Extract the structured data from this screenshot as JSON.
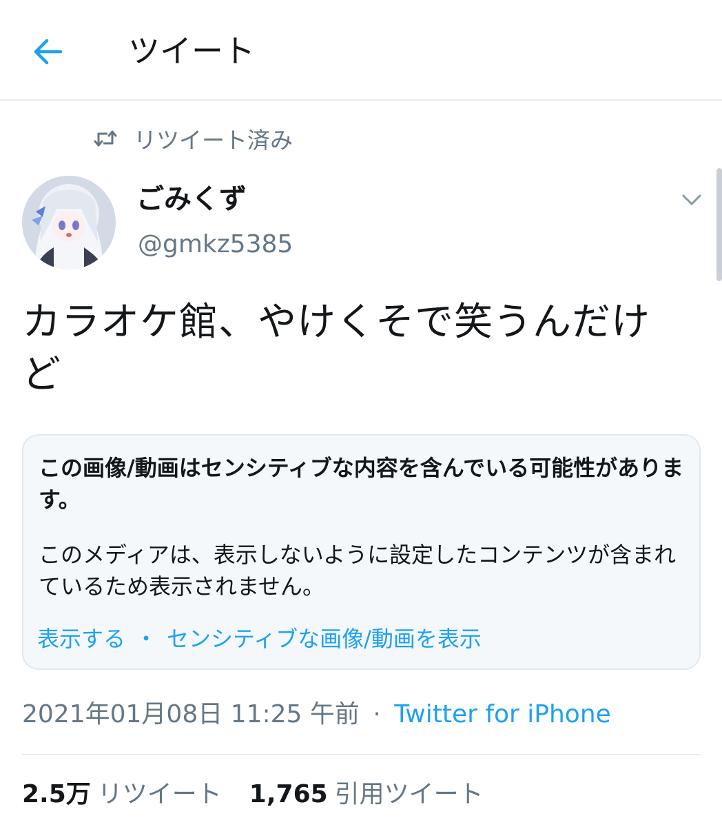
{
  "header": {
    "title": "ツイート",
    "back_icon": "arrow-left-icon"
  },
  "retweet_context": {
    "label": "リツイート済み",
    "icon": "retweet-icon"
  },
  "author": {
    "name": "ごみくず",
    "handle": "@gmkz5385",
    "avatar_icon": "avatar-illustration"
  },
  "tweet": {
    "text": "カラオケ館、やけくそで笑うんだけど"
  },
  "sensitive_notice": {
    "title": "この画像/動画はセンシティブな内容を含んでいる可能性があります。",
    "body": "このメディアは、表示しないように設定したコンテンツが含まれているため表示されません。",
    "show_label": "表示する",
    "separator": "・",
    "settings_label": "センシティブな画像/動画を表示"
  },
  "meta": {
    "timestamp": "2021年01月08日 11:25 午前",
    "separator": "·",
    "source": "Twitter for iPhone"
  },
  "stats": {
    "retweets_count": "2.5万",
    "retweets_label": "リツイート",
    "quotes_count": "1,765",
    "quotes_label": "引用ツイート"
  },
  "colors": {
    "accent": "#1da1f2",
    "text_primary": "#14171a",
    "text_secondary": "#657786",
    "border": "#e6ecf0",
    "card_bg": "#f5f8fa"
  }
}
